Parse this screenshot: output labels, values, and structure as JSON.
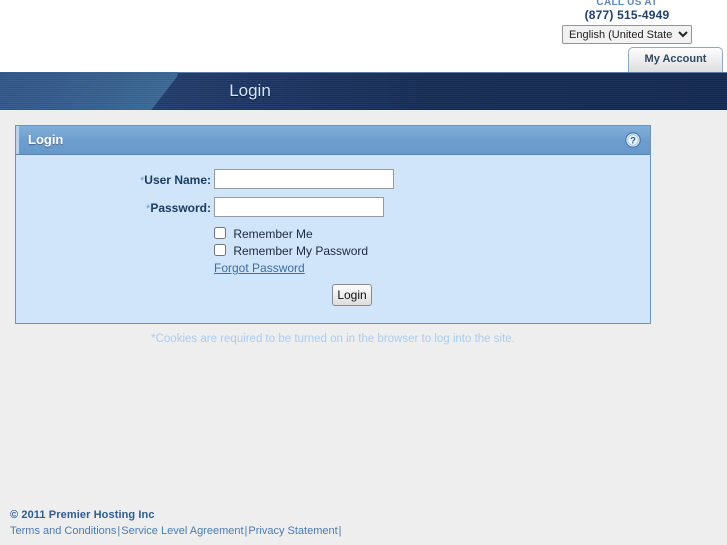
{
  "header": {
    "call_us_label": "CALL US AT",
    "phone": "(877) 515-4949",
    "language_selected": "English (United States)",
    "language_options": [
      "English (United States)"
    ],
    "account_tab_label": "My Account"
  },
  "banner": {
    "title": "Login"
  },
  "login_panel": {
    "title": "Login",
    "help_icon": "help-question-icon",
    "fields": {
      "username": {
        "label": "User Name:",
        "required_marker": "*",
        "value": ""
      },
      "password": {
        "label": "Password:",
        "required_marker": "*",
        "value": ""
      }
    },
    "checkboxes": [
      {
        "label": "Remember Me",
        "checked": false
      },
      {
        "label": "Remember My Password",
        "checked": false
      }
    ],
    "forgot_password_link": "Forgot Password",
    "submit_label": "Login",
    "cookie_note": "*Cookies are required to be turned on in the browser to log into the site."
  },
  "footer": {
    "copyright": "© 2011 Premier Hosting Inc",
    "links": [
      "Terms and Conditions",
      "Service Level Agreement",
      "Privacy Statement"
    ],
    "separator": "|"
  },
  "colors": {
    "page_background": "#eeeeee",
    "banner_navy": "#152c55",
    "banner_swoosh_blue": "#36608f",
    "panel_background": "#d0e4fa",
    "panel_header_blue": "#6d9ecd",
    "panel_border": "#6d94bd",
    "label_navy": "#1b3c63",
    "link_blue": "#3a6ea5",
    "footer_blue": "#4a7cae",
    "phone_navy": "#1f3f6e"
  }
}
